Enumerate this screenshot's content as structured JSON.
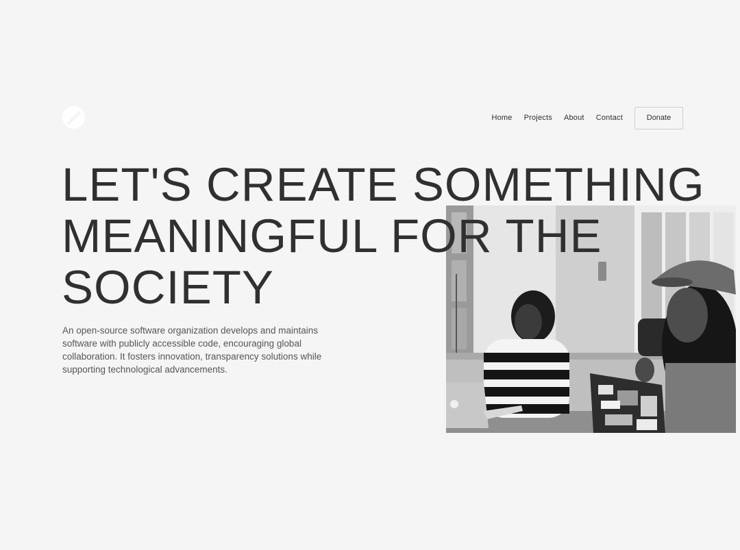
{
  "logo": {
    "icon": "slash-circle-icon"
  },
  "nav": {
    "items": [
      "Home",
      "Projects",
      "About",
      "Contact"
    ],
    "donate_label": "Donate"
  },
  "hero": {
    "headline_lines": [
      "LET'S CREATE SOMETHING",
      "MEANINGFUL FOR THE",
      "SOCIETY"
    ],
    "description": "An open-source software organization develops and maintains software with publicly accessible code, encouraging global collaboration. It fosters innovation, transparency solutions while supporting technological advancements."
  },
  "colors": {
    "background": "#f5f5f5",
    "text": "#303030",
    "muted_text": "#555555"
  }
}
